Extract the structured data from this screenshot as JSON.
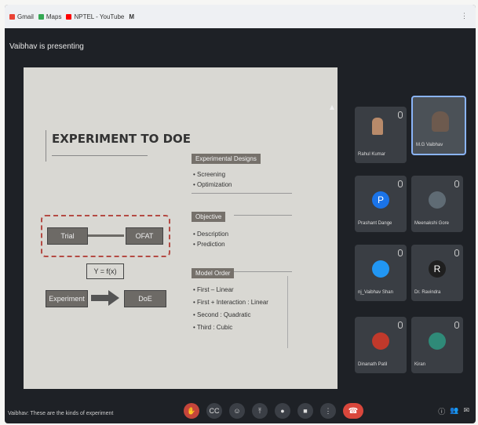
{
  "browser": {
    "bookmarks": [
      {
        "label": "Gmail",
        "color": "#ea4335"
      },
      {
        "label": "Maps",
        "color": "#34a853"
      },
      {
        "label": "NPTEL - YouTube",
        "color": "#ff0000"
      },
      {
        "label": "M",
        "color": "#333333"
      }
    ],
    "right_icon": "⋮"
  },
  "meet": {
    "presenting_label": "Vaibhav is presenting",
    "caption": "Vaibhav: These are the kinds of experiment"
  },
  "slide": {
    "title": "EXPERIMENT TO DOE",
    "trial": "Trial",
    "ofat": "OFAT",
    "equation": "Y = f(x)",
    "experiment": "Experiment",
    "doe": "DoE",
    "sections": [
      {
        "header": "Experimental Designs",
        "bullets": [
          "Screening",
          "Optimization"
        ]
      },
      {
        "header": "Objective",
        "bullets": [
          "Description",
          "Prediction"
        ]
      },
      {
        "header": "Model Order",
        "bullets": [
          "First – Linear",
          "First + Interaction : Linear",
          "Second : Quadratic",
          "Third : Cubic"
        ]
      }
    ]
  },
  "participants": [
    {
      "name": "Rahul Kumar",
      "initial": "",
      "color": "#3a3e44"
    },
    {
      "name": "M.G Vaibhav",
      "initial": "",
      "color": "#3a3e44"
    },
    {
      "name": "Prashant Dange",
      "initial": "P",
      "color": "#1a73e8"
    },
    {
      "name": "Meenakshi Gore",
      "initial": "",
      "color": "#5f6b74"
    },
    {
      "name": "nj_Vaibhav Shan",
      "initial": "",
      "color": "#2196f3"
    },
    {
      "name": "Dr. Ravindra",
      "initial": "R",
      "color": "#1f1f1f"
    },
    {
      "name": "Dinanath Patil",
      "initial": "",
      "color": "#c0392b"
    },
    {
      "name": "Kiran",
      "initial": "",
      "color": "#2f8a78"
    }
  ],
  "controls": [
    {
      "name": "raise-hand",
      "glyph": "✋"
    },
    {
      "name": "captions",
      "glyph": "CC"
    },
    {
      "name": "emoji",
      "glyph": "☺"
    },
    {
      "name": "present",
      "glyph": "⤒"
    },
    {
      "name": "mic",
      "glyph": "●"
    },
    {
      "name": "camera",
      "glyph": "■"
    },
    {
      "name": "more",
      "glyph": "⋮"
    }
  ],
  "end_call_glyph": "☎",
  "colors": {
    "slide_bg": "#d9d8d3",
    "box": "#6d6a66",
    "dash": "#b44b44",
    "meet_bg": "#1e2126",
    "end_call": "#d9473c"
  }
}
